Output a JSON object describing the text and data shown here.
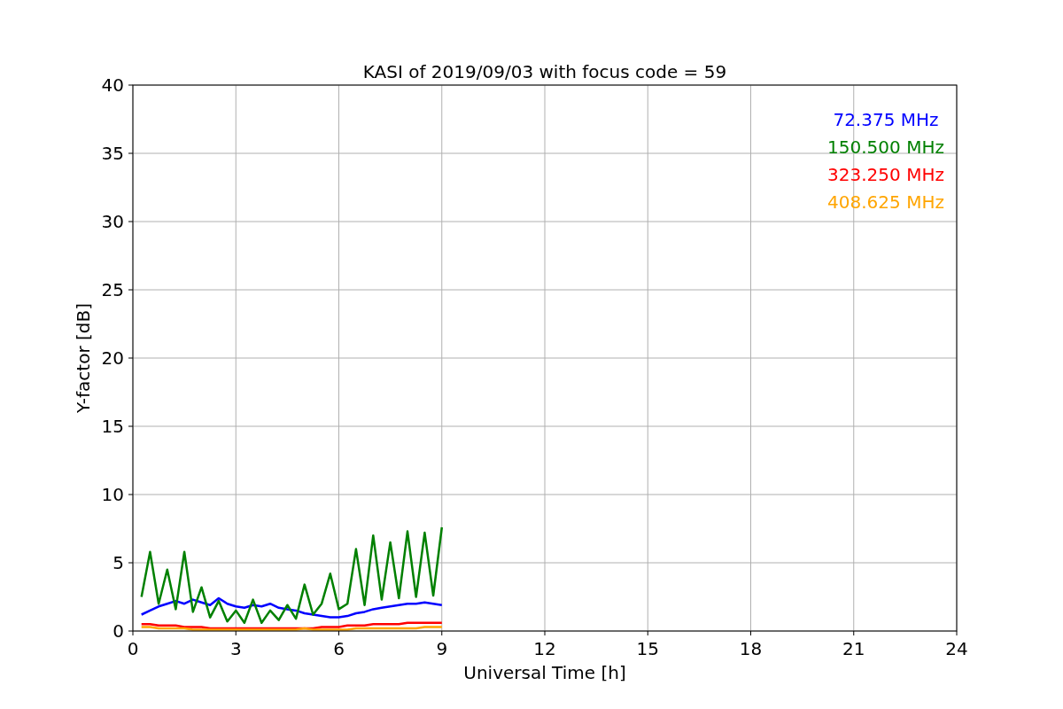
{
  "chart_data": {
    "type": "line",
    "title": "KASI of 2019/09/03 with focus code = 59",
    "xlabel": "Universal Time [h]",
    "ylabel": "Y-factor [dB]",
    "x": [
      0.25,
      0.5,
      0.75,
      1,
      1.25,
      1.5,
      1.75,
      2,
      2.25,
      2.5,
      2.75,
      3,
      3.25,
      3.5,
      3.75,
      4,
      4.25,
      4.5,
      4.75,
      5,
      5.25,
      5.5,
      5.75,
      6,
      6.25,
      6.5,
      6.75,
      7,
      7.25,
      7.5,
      7.75,
      8,
      8.25,
      8.5,
      8.75,
      9
    ],
    "xlim": [
      0,
      24
    ],
    "ylim": [
      0,
      40
    ],
    "grid": true,
    "xticks": [
      0,
      3,
      6,
      9,
      12,
      15,
      18,
      21,
      24
    ],
    "yticks": [
      0,
      5,
      10,
      15,
      20,
      25,
      30,
      35,
      40
    ],
    "series": [
      {
        "name": "72.375 MHz",
        "color": "#0000ff",
        "values": [
          1.2,
          1.5,
          1.8,
          2.0,
          2.2,
          2.0,
          2.3,
          2.1,
          1.9,
          2.4,
          2.0,
          1.8,
          1.7,
          1.9,
          1.8,
          2.0,
          1.7,
          1.6,
          1.5,
          1.3,
          1.2,
          1.1,
          1.0,
          1.0,
          1.1,
          1.3,
          1.4,
          1.6,
          1.7,
          1.8,
          1.9,
          2.0,
          2.0,
          2.1,
          2.0,
          1.9
        ]
      },
      {
        "name": "150.500 MHz",
        "color": "#008000",
        "values": [
          2.5,
          5.8,
          2.0,
          4.5,
          1.6,
          5.8,
          1.4,
          3.2,
          1.0,
          2.2,
          0.7,
          1.5,
          0.6,
          2.3,
          0.6,
          1.5,
          0.8,
          1.9,
          0.9,
          3.4,
          1.2,
          2.0,
          4.2,
          1.6,
          2.0,
          6.0,
          1.9,
          7.0,
          2.3,
          6.5,
          2.4,
          7.3,
          2.5,
          7.2,
          2.6,
          7.6
        ]
      },
      {
        "name": "323.250 MHz",
        "color": "#ff0000",
        "values": [
          0.5,
          0.5,
          0.4,
          0.4,
          0.4,
          0.3,
          0.3,
          0.3,
          0.2,
          0.2,
          0.2,
          0.2,
          0.2,
          0.2,
          0.2,
          0.2,
          0.2,
          0.2,
          0.2,
          0.2,
          0.2,
          0.3,
          0.3,
          0.3,
          0.4,
          0.4,
          0.4,
          0.5,
          0.5,
          0.5,
          0.5,
          0.6,
          0.6,
          0.6,
          0.6,
          0.6
        ]
      },
      {
        "name": "408.625 MHz",
        "color": "#ffa500",
        "values": [
          0.3,
          0.3,
          0.2,
          0.2,
          0.2,
          0.2,
          0.1,
          0.1,
          0.1,
          0.1,
          0.1,
          0.1,
          0.1,
          0.1,
          0.1,
          0.1,
          0.1,
          0.1,
          0.1,
          0.2,
          0.1,
          0.1,
          0.1,
          0.1,
          0.1,
          0.2,
          0.2,
          0.2,
          0.2,
          0.2,
          0.2,
          0.2,
          0.2,
          0.3,
          0.3,
          0.3
        ]
      }
    ]
  }
}
